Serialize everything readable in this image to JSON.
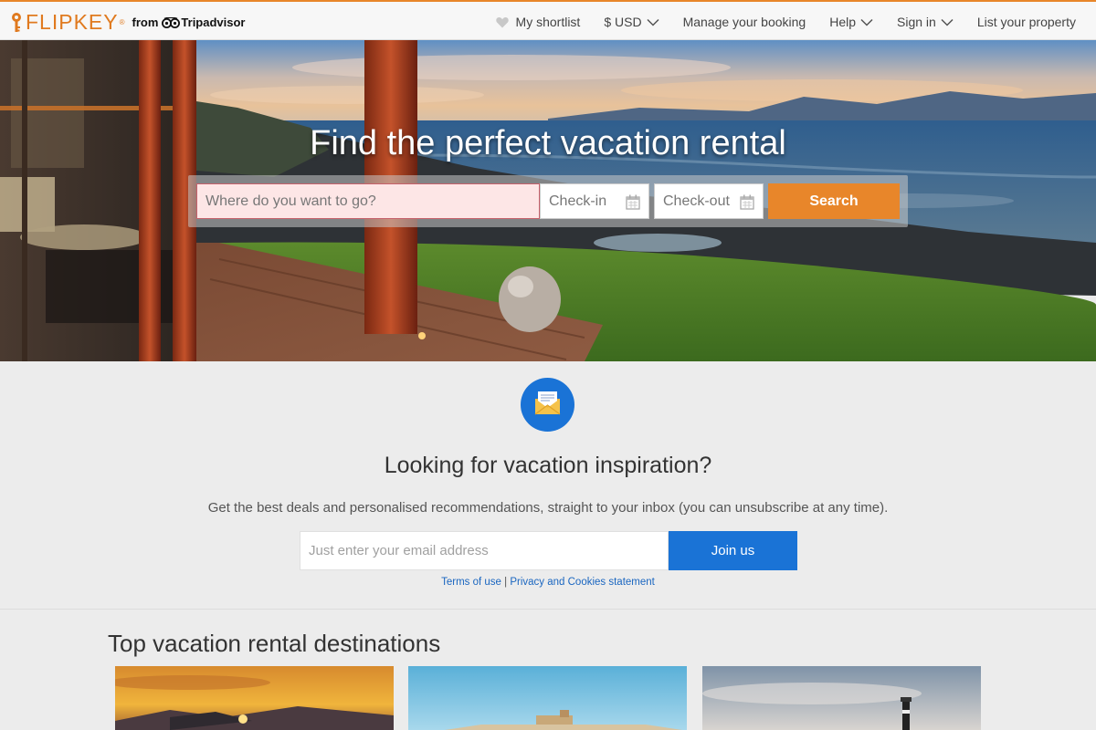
{
  "header": {
    "logo_text": "FLIPKEY",
    "logo_tm": "®",
    "logo_from": "from",
    "logo_partner": "Tripadvisor",
    "nav": {
      "shortlist": "My shortlist",
      "currency": "$ USD",
      "manage_booking": "Manage your booking",
      "help": "Help",
      "sign_in": "Sign in",
      "list_property": "List your property"
    }
  },
  "hero": {
    "title": "Find the perfect vacation rental",
    "search": {
      "destination_placeholder": "Where do you want to go?",
      "checkin_label": "Check-in",
      "checkout_label": "Check-out",
      "search_label": "Search"
    }
  },
  "newsletter": {
    "title": "Looking for vacation inspiration?",
    "subtitle": "Get the best deals and personalised recommendations, straight to your inbox (you can unsubscribe at any time).",
    "email_placeholder": "Just enter your email address",
    "join_label": "Join us",
    "terms_label": "Terms of use",
    "separator": "|",
    "privacy_label": "Privacy and Cookies statement"
  },
  "destinations": {
    "title": "Top vacation rental destinations"
  },
  "colors": {
    "brand_orange": "#e8862a",
    "brand_blue": "#1a73d6",
    "search_input_bg": "#fde6e6",
    "search_input_border": "#c6616b"
  },
  "icons": {
    "shortlist": "heart-icon",
    "dropdown": "chevron-down-icon",
    "calendar": "calendar-icon",
    "newsletter": "envelope-icon"
  }
}
